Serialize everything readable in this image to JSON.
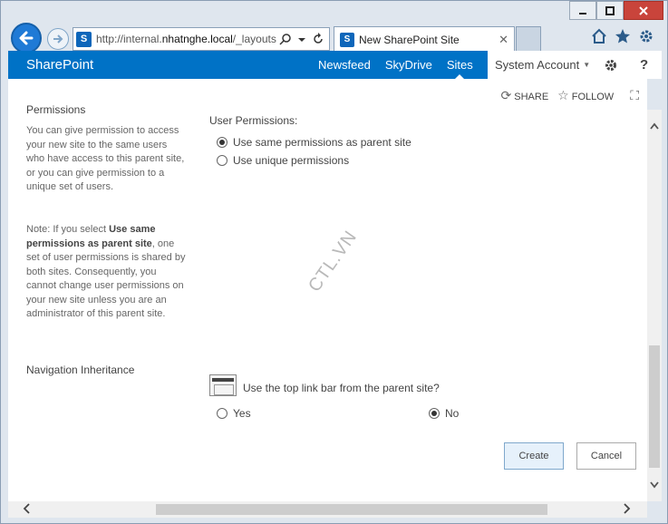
{
  "browser": {
    "url_prefix": "http://internal.",
    "url_domain": "nhatnghe.local",
    "url_suffix": "/_layouts",
    "tab_title": "New SharePoint Site",
    "sp_glyph": "S"
  },
  "suitebar": {
    "brand": "SharePoint",
    "links": [
      "Newsfeed",
      "SkyDrive",
      "Sites"
    ],
    "account": "System Account"
  },
  "toolbar": {
    "share": "SHARE",
    "follow": "FOLLOW"
  },
  "permissions": {
    "heading": "Permissions",
    "description": "You can give permission to access your new site to the same users who have access to this parent site, or you can give permission to a unique set of users.",
    "note_prefix": "Note: If you select ",
    "note_bold": "Use same permissions as parent site",
    "note_suffix": ", one set of user permissions is shared by both sites. Consequently, you cannot change user permissions on your new site unless you are an administrator of this parent site.",
    "label": "User Permissions:",
    "options": [
      "Use same permissions as parent site",
      "Use unique permissions"
    ],
    "selected_index": 0
  },
  "navigation": {
    "heading": "Navigation Inheritance",
    "question": "Use the top link bar from the parent site?",
    "yes": "Yes",
    "no": "No",
    "selected": "No"
  },
  "buttons": {
    "create": "Create",
    "cancel": "Cancel"
  },
  "watermark": "CTL.VN",
  "icons": {
    "back": "arrow-left-icon",
    "forward": "arrow-right-icon",
    "search": "search-icon",
    "refresh": "refresh-icon",
    "home": "home-icon",
    "favorites": "star-icon",
    "settings": "gear-icon",
    "help": "question-icon",
    "share": "share-icon",
    "follow": "star-outline-icon",
    "focus": "focus-icon"
  },
  "colors": {
    "suitebar": "#0072c6",
    "accent": "#1f7ad6",
    "close": "#c9443b"
  }
}
